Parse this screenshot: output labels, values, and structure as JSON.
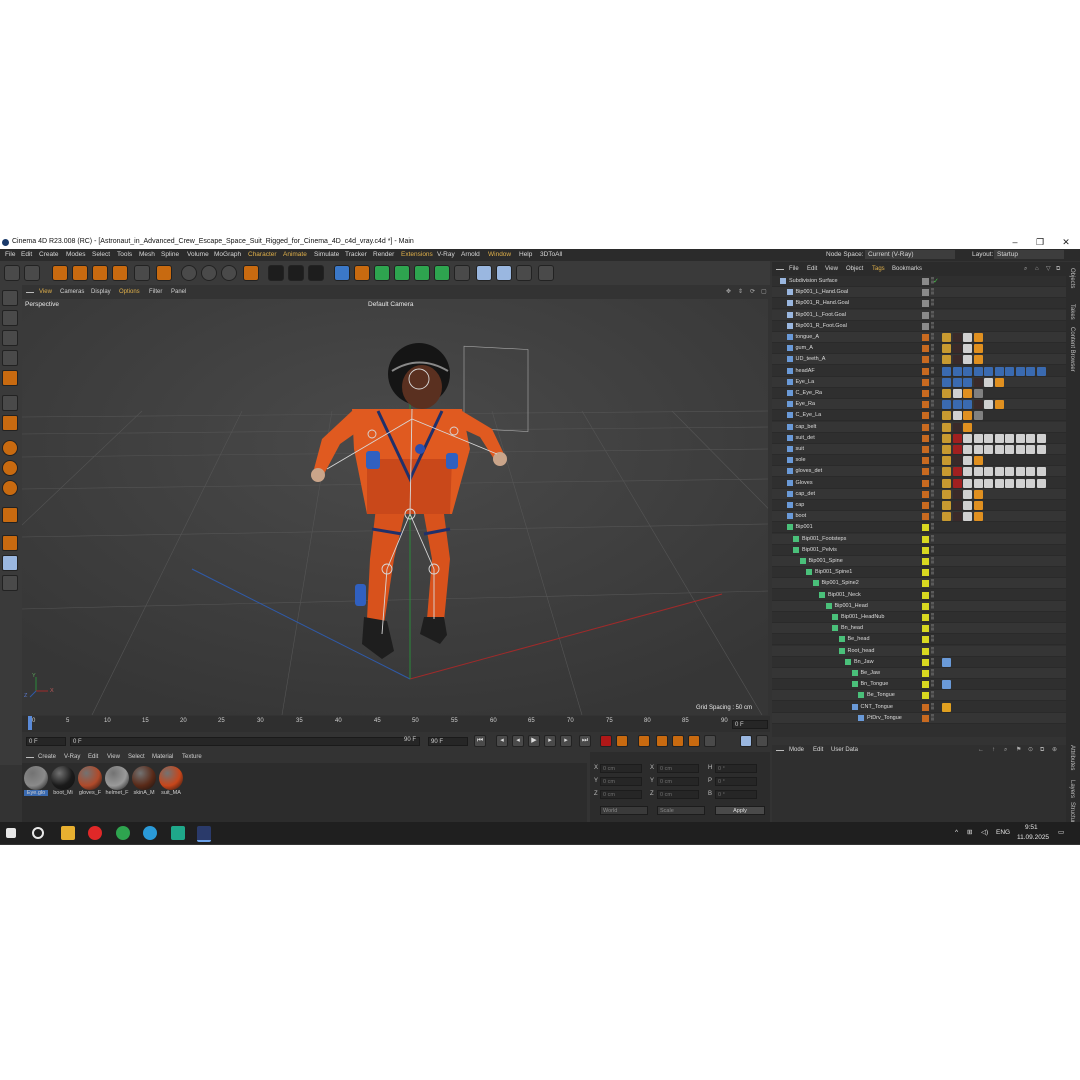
{
  "window": {
    "title": "Cinema 4D R23.008 (RC) - [Astronaut_in_Advanced_Crew_Escape_Space_Suit_Rigged_for_Cinema_4D_c4d_vray.c4d *] - Main",
    "minimize": "–",
    "maximize": "❐",
    "close": "✕"
  },
  "menubar": {
    "items": [
      "File",
      "Edit",
      "Create",
      "Modes",
      "Select",
      "Tools",
      "Mesh",
      "Spline",
      "Volume",
      "MoGraph",
      "Character",
      "Animate",
      "Simulate",
      "Tracker",
      "Render",
      "Extensions",
      "V-Ray",
      "Arnold",
      "Window",
      "Help",
      "3DToAll"
    ],
    "node_space_label": "Node Space:",
    "node_space_value": "Current (V-Ray)",
    "layout_label": "Layout:",
    "layout_value": "Startup"
  },
  "viewport": {
    "menu": [
      "View",
      "Cameras",
      "Display",
      "Options",
      "Filter",
      "Panel"
    ],
    "name": "Perspective",
    "camera": "Default Camera",
    "grid_spacing": "Grid Spacing : 50 cm",
    "axis_y": "Y",
    "axis_z": "Z",
    "axis_x": "X"
  },
  "timeline": {
    "ticks": [
      "0",
      "5",
      "10",
      "15",
      "20",
      "25",
      "30",
      "35",
      "40",
      "45",
      "50",
      "55",
      "60",
      "65",
      "70",
      "75",
      "80",
      "85",
      "90"
    ],
    "frame_field": "0 F",
    "start_field": "0 F",
    "current_field": "0 F",
    "end_field_a": "90 F",
    "end_field_b": "90 F"
  },
  "materials": {
    "menu": [
      "Create",
      "V-Ray",
      "Edit",
      "View",
      "Select",
      "Material",
      "Texture"
    ],
    "items": [
      {
        "label": "Eye.glo",
        "color": "#8a8a8a"
      },
      {
        "label": "boot_Mi",
        "color": "#1a1a1a"
      },
      {
        "label": "gloves_F",
        "color": "#b04a2a"
      },
      {
        "label": "helmet_F",
        "color": "#9a9a9a"
      },
      {
        "label": "skinA_M",
        "color": "#5a2a18"
      },
      {
        "label": "suit_MA",
        "color": "#c8461a"
      }
    ]
  },
  "coordinates": {
    "rows": [
      {
        "a": "X",
        "av": "0 cm",
        "b": "X",
        "bv": "0 cm",
        "c": "H",
        "cv": "0 °"
      },
      {
        "a": "Y",
        "av": "0 cm",
        "b": "Y",
        "bv": "0 cm",
        "c": "P",
        "cv": "0 °"
      },
      {
        "a": "Z",
        "av": "0 cm",
        "b": "Z",
        "bv": "0 cm",
        "c": "B",
        "cv": "0 °"
      }
    ],
    "world": "World",
    "scale": "Scale",
    "apply": "Apply"
  },
  "objects": {
    "menu": [
      "File",
      "Edit",
      "View",
      "Object",
      "Tags",
      "Bookmarks"
    ],
    "rows": [
      {
        "name": "Subdivision Surface",
        "indent": 0,
        "sq": "#8a8a8a",
        "tags": [
          "check"
        ]
      },
      {
        "name": "Bip001_L_Hand.Goal",
        "indent": 1,
        "sq": "#8a8a8a",
        "tags": []
      },
      {
        "name": "Bip001_R_Hand.Goal",
        "indent": 1,
        "sq": "#8a8a8a",
        "tags": []
      },
      {
        "name": "Bip001_L_Foot.Goal",
        "indent": 1,
        "sq": "#8a8a8a",
        "tags": []
      },
      {
        "name": "Bip001_R_Foot.Goal",
        "indent": 1,
        "sq": "#8a8a8a",
        "tags": []
      },
      {
        "name": "tongue_A",
        "indent": 1,
        "sq": "#c86a20",
        "tags": [
          "a",
          "b",
          "c",
          "d"
        ]
      },
      {
        "name": "gum_A",
        "indent": 1,
        "sq": "#c86a20",
        "tags": [
          "a",
          "b",
          "c",
          "d"
        ]
      },
      {
        "name": "UD_teeth_A",
        "indent": 1,
        "sq": "#c86a20",
        "tags": [
          "a",
          "b",
          "c",
          "d"
        ]
      },
      {
        "name": "headAF",
        "indent": 1,
        "sq": "#c86a20",
        "tags": [
          "e",
          "e",
          "e",
          "e",
          "e",
          "e",
          "e",
          "e",
          "e",
          "e"
        ]
      },
      {
        "name": "Eye_La",
        "indent": 1,
        "sq": "#c86a20",
        "tags": [
          "e",
          "e",
          "e",
          "b",
          "c",
          "d"
        ]
      },
      {
        "name": "C_Eye_Ra",
        "indent": 1,
        "sq": "#c86a20",
        "tags": [
          "a",
          "c",
          "d",
          "f"
        ]
      },
      {
        "name": "Eye_Ra",
        "indent": 1,
        "sq": "#c86a20",
        "tags": [
          "e",
          "e",
          "e",
          "b",
          "c",
          "d"
        ]
      },
      {
        "name": "C_Eye_La",
        "indent": 1,
        "sq": "#c86a20",
        "tags": [
          "a",
          "c",
          "d",
          "f"
        ]
      },
      {
        "name": "cap_belt",
        "indent": 1,
        "sq": "#c86a20",
        "tags": [
          "a",
          "b",
          "d"
        ]
      },
      {
        "name": "suit_det",
        "indent": 1,
        "sq": "#c86a20",
        "tags": [
          "a",
          "g",
          "c",
          "c",
          "c",
          "c",
          "c",
          "c",
          "c",
          "c"
        ]
      },
      {
        "name": "suit",
        "indent": 1,
        "sq": "#c86a20",
        "tags": [
          "a",
          "g",
          "c",
          "c",
          "c",
          "c",
          "c",
          "c",
          "c",
          "c"
        ]
      },
      {
        "name": "sole",
        "indent": 1,
        "sq": "#c86a20",
        "tags": [
          "a",
          "b",
          "c",
          "d"
        ]
      },
      {
        "name": "gloves_det",
        "indent": 1,
        "sq": "#c86a20",
        "tags": [
          "a",
          "g",
          "c",
          "c",
          "c",
          "c",
          "c",
          "c",
          "c",
          "c"
        ]
      },
      {
        "name": "Gloves",
        "indent": 1,
        "sq": "#c86a20",
        "tags": [
          "a",
          "g",
          "c",
          "c",
          "c",
          "c",
          "c",
          "c",
          "c",
          "c"
        ]
      },
      {
        "name": "cap_det",
        "indent": 1,
        "sq": "#c86a20",
        "tags": [
          "a",
          "b",
          "c",
          "d"
        ]
      },
      {
        "name": "cap",
        "indent": 1,
        "sq": "#c86a20",
        "tags": [
          "a",
          "b",
          "c",
          "d"
        ]
      },
      {
        "name": "boot",
        "indent": 1,
        "sq": "#c86a20",
        "tags": [
          "a",
          "b",
          "c",
          "d"
        ]
      },
      {
        "name": "Bip001",
        "indent": 1,
        "sq": "#d8d820",
        "tags": []
      },
      {
        "name": "Bip001_Footsteps",
        "indent": 2,
        "sq": "#d8d820",
        "tags": []
      },
      {
        "name": "Bip001_Pelvis",
        "indent": 2,
        "sq": "#d8d820",
        "tags": []
      },
      {
        "name": "Bip001_Spine",
        "indent": 3,
        "sq": "#d8d820",
        "tags": []
      },
      {
        "name": "Bip001_Spine1",
        "indent": 4,
        "sq": "#d8d820",
        "tags": []
      },
      {
        "name": "Bip001_Spine2",
        "indent": 5,
        "sq": "#d8d820",
        "tags": []
      },
      {
        "name": "Bip001_Neck",
        "indent": 6,
        "sq": "#d8d820",
        "tags": []
      },
      {
        "name": "Bip001_Head",
        "indent": 7,
        "sq": "#d8d820",
        "tags": []
      },
      {
        "name": "Bip001_HeadNub",
        "indent": 8,
        "sq": "#d8d820",
        "tags": []
      },
      {
        "name": "Bn_head",
        "indent": 8,
        "sq": "#d8d820",
        "tags": []
      },
      {
        "name": "Be_head",
        "indent": 9,
        "sq": "#d8d820",
        "tags": []
      },
      {
        "name": "Root_head",
        "indent": 9,
        "sq": "#d8d820",
        "tags": []
      },
      {
        "name": "Bn_Jaw",
        "indent": 10,
        "sq": "#d8d820",
        "tags": [
          "h"
        ]
      },
      {
        "name": "Be_Jaw",
        "indent": 11,
        "sq": "#d8d820",
        "tags": []
      },
      {
        "name": "Bn_Tongue",
        "indent": 11,
        "sq": "#d8d820",
        "tags": [
          "h"
        ]
      },
      {
        "name": "Be_Tongue",
        "indent": 12,
        "sq": "#d8d820",
        "tags": []
      },
      {
        "name": "CNT_Tongue",
        "indent": 11,
        "sq": "#c86a20",
        "tags": [
          "i"
        ]
      },
      {
        "name": "PtDrv_Tongue",
        "indent": 12,
        "sq": "#c86a20",
        "tags": []
      }
    ]
  },
  "attributes": {
    "menu": [
      "Mode",
      "Edit",
      "User Data"
    ]
  },
  "right_tabs": [
    "Objects",
    "Takes",
    "Content Browser",
    "Attributes",
    "Layers",
    "Structure"
  ],
  "taskbar": {
    "lang": "ENG",
    "time": "9:51",
    "date": "11.09.2025"
  }
}
